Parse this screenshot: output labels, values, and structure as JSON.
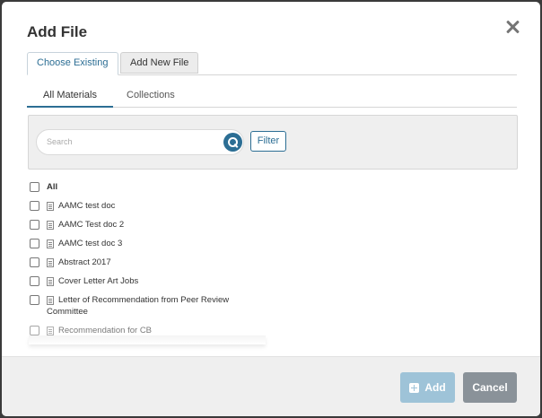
{
  "modal": {
    "title": "Add File"
  },
  "top_tabs": [
    {
      "label": "Choose Existing",
      "active": true
    },
    {
      "label": "Add New File",
      "active": false
    }
  ],
  "sub_tabs": [
    {
      "label": "All Materials",
      "active": true
    },
    {
      "label": "Collections",
      "active": false
    }
  ],
  "search": {
    "placeholder": "Search",
    "filter_label": "Filter"
  },
  "list": {
    "all_label": "All",
    "items": [
      {
        "name": "AAMC test doc",
        "icon": "document-icon"
      },
      {
        "name": "AAMC Test doc 2",
        "icon": "document-icon"
      },
      {
        "name": "AAMC test doc 3",
        "icon": "document-icon"
      },
      {
        "name": "Abstract 2017",
        "icon": "document-icon"
      },
      {
        "name": "Cover Letter Art Jobs",
        "icon": "document-icon"
      },
      {
        "name_line1": "Letter of Recommendation from Peer Review",
        "name_line2": "Committee",
        "icon": "document-icon"
      },
      {
        "name": "Recommendation for CB",
        "icon": "document-icon"
      }
    ]
  },
  "footer": {
    "add_label": "Add",
    "cancel_label": "Cancel"
  },
  "colors": {
    "accent": "#2c6e94",
    "add_disabled": "#9ec3d8",
    "cancel": "#8a9299"
  }
}
